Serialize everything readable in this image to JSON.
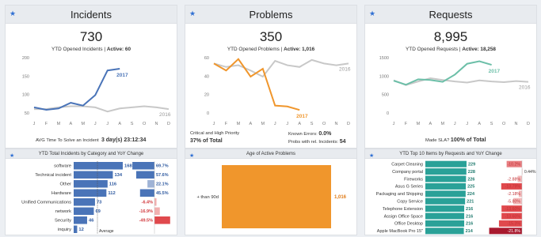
{
  "colors": {
    "accent": "#2f6fd3",
    "blue_bar": "#4a74b8",
    "orange": "#f0962c",
    "teal": "#6cbfa8",
    "gray_line": "#c8c8c8",
    "red": "#e0494d"
  },
  "months": [
    "J",
    "F",
    "M",
    "A",
    "M",
    "J",
    "J",
    "A",
    "S",
    "O",
    "N",
    "D"
  ],
  "incidents": {
    "title": "Incidents",
    "icon": "star-icon",
    "total": "730",
    "sub_prefix": "YTD Opened Incidents | ",
    "active_label": "Active: 60",
    "y_ticks": [
      "200",
      "150",
      "100",
      "50"
    ],
    "chart_data": {
      "type": "line",
      "ylim": [
        30,
        210
      ],
      "series": [
        {
          "name": "2017",
          "values": [
            55,
            48,
            52,
            68,
            60,
            90,
            160,
            165
          ]
        },
        {
          "name": "2016",
          "values": [
            50,
            50,
            55,
            58,
            58,
            55,
            43,
            52,
            55,
            58,
            55,
            50
          ]
        }
      ]
    },
    "avg_label": "AVG Time To Solve an Incident",
    "avg_value": "3 day(s) 23:12:34"
  },
  "problems": {
    "title": "Problems",
    "icon": "star-icon",
    "total": "350",
    "sub_prefix": "YTD Opened Problems | ",
    "active_label": "Active: 1,016",
    "y_ticks": [
      "60",
      "40",
      "20",
      "0"
    ],
    "chart_data": {
      "type": "line",
      "ylim": [
        0,
        72
      ],
      "series": [
        {
          "name": "2017",
          "values": [
            60,
            52,
            65,
            45,
            54,
            12,
            11,
            7
          ]
        },
        {
          "name": "2016",
          "values": [
            60,
            56,
            58,
            52,
            45,
            63,
            58,
            56,
            64,
            60,
            58,
            60
          ]
        }
      ]
    },
    "crit_label": "Critical and High Priority",
    "crit_value": "37% of Total",
    "known_errors_label": "Known Errors:",
    "known_errors_value": "0.0%",
    "probs_incidents_label": "Probs with rel. Incidents:",
    "probs_incidents_value": "54"
  },
  "requests": {
    "title": "Requests",
    "icon": "star-icon",
    "total": "8,995",
    "sub_prefix": "YTD Opened Requests | ",
    "active_label": "Active: 18,258",
    "y_ticks": [
      "1500",
      "1000",
      "500",
      "0"
    ],
    "chart_data": {
      "type": "line",
      "ylim": [
        0,
        1750
      ],
      "series": [
        {
          "name": "2017",
          "values": [
            980,
            870,
            1020,
            1000,
            950,
            1150,
            1450,
            1520,
            1420
          ]
        },
        {
          "name": "2016",
          "values": [
            990,
            860,
            960,
            1050,
            1000,
            960,
            930,
            990,
            960,
            940,
            970,
            950
          ]
        }
      ]
    },
    "sla_label": "Made SLA?",
    "sla_value": "100% of Total"
  },
  "incident_categories": {
    "title": "YTD Total Incidents by Category and YoY Change",
    "average_label": "Average",
    "chart_data": {
      "type": "bar",
      "categories": [
        "software",
        "Technical incident",
        "Other",
        "Hardware",
        "Unified Communications",
        "network",
        "Security",
        "inquiry"
      ],
      "values": [
        168,
        134,
        116,
        112,
        73,
        69,
        46,
        12
      ],
      "value_labels": [
        "168",
        "134",
        "116",
        "112",
        "73",
        "69",
        "46",
        "12"
      ],
      "yoy": [
        69.7,
        57.6,
        22.1,
        45.5,
        -6.4,
        -16.9,
        -49.5,
        null
      ],
      "yoy_labels": [
        "69.7%",
        "57.6%",
        "22.1%",
        "45.5%",
        "-6.4%",
        "-16.9%",
        "-49.5%",
        ""
      ]
    }
  },
  "age_active": {
    "title": "Age of Active Problems",
    "chart_data": {
      "type": "bar",
      "categories": [
        "+ than 90d"
      ],
      "values": [
        1016
      ],
      "value_labels": [
        "1,016"
      ]
    }
  },
  "top_items": {
    "title": "YTD Top 10 Items by Requests and YoY Change",
    "chart_data": {
      "type": "bar",
      "categories": [
        "Carpet Cleaning",
        "Company portal",
        "Fireworks",
        "Asus G Series",
        "Packaging and Shipping",
        "Copy Service",
        "Telephone Extension",
        "Assign Office Space",
        "Office Desktop",
        "Apple MacBook Pro 15\""
      ],
      "values": [
        229,
        228,
        226,
        225,
        224,
        221,
        216,
        216,
        216,
        214
      ],
      "value_labels": [
        "229",
        "228",
        "226",
        "225",
        "224",
        "221",
        "216",
        "216",
        "216",
        "214"
      ],
      "yoy": [
        -10.2,
        0.44,
        -2.88,
        -13.79,
        -2.18,
        -5.8,
        -13.6,
        -13.6,
        -15.3,
        -21.8
      ],
      "yoy_labels": [
        "-10.2%",
        "0.44%",
        "-2.88%",
        "-13.79%",
        "-2.18%",
        "-5.80%",
        "-13.60%",
        "-13.60%",
        "-15.3%",
        "-21.8%"
      ]
    }
  }
}
